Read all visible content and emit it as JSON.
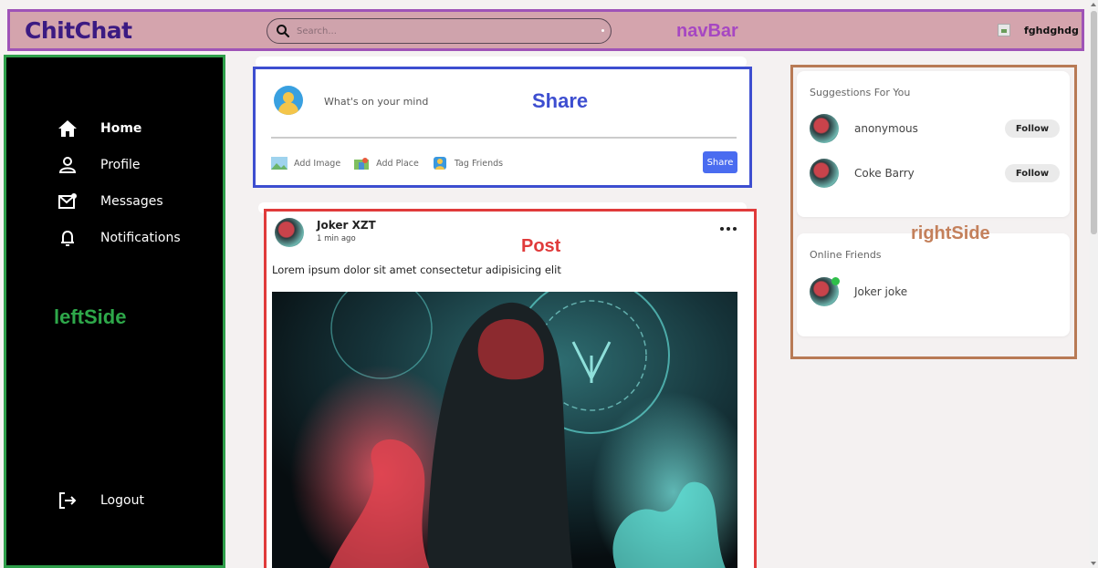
{
  "navbar": {
    "logo": "ChitChat",
    "search_placeholder": "Search...",
    "annotation": "navBar",
    "username": "fghdghdg"
  },
  "leftside": {
    "annotation": "leftSide",
    "menu": [
      {
        "label": "Home",
        "icon": "home-icon",
        "active": true
      },
      {
        "label": "Profile",
        "icon": "user-icon"
      },
      {
        "label": "Messages",
        "icon": "mail-icon"
      },
      {
        "label": "Notifications",
        "icon": "bell-icon"
      }
    ],
    "logout": {
      "label": "Logout",
      "icon": "logout-icon"
    }
  },
  "share": {
    "annotation": "Share",
    "placeholder": "What's on your mind",
    "options": [
      {
        "label": "Add Image",
        "icon": "image-icon"
      },
      {
        "label": "Add Place",
        "icon": "map-icon"
      },
      {
        "label": "Tag Friends",
        "icon": "tag-friends-icon"
      }
    ],
    "button": "Share"
  },
  "post": {
    "annotation": "Post",
    "author": "Joker XZT",
    "time": "1 min ago",
    "caption": "Lorem ipsum dolor sit amet consectetur adipisicing elit"
  },
  "rightside": {
    "annotation": "rightSide",
    "suggestions_title": "Suggestions For You",
    "suggestions": [
      {
        "name": "anonymous",
        "button": "Follow"
      },
      {
        "name": "Coke Barry",
        "button": "Follow"
      }
    ],
    "online_title": "Online Friends",
    "online": [
      {
        "name": "Joker joke"
      }
    ]
  },
  "colors": {
    "navbar_bg": "#d4a4ad",
    "navbar_border": "#9f53b7",
    "logo": "#3b1a82",
    "leftside_border": "#2e9e4a",
    "share_border": "#3d4ed0",
    "post_border": "#e03b3b",
    "rightside_border": "#b87a55",
    "share_button": "#4a6cf0",
    "online_dot": "#2fbf4a"
  }
}
